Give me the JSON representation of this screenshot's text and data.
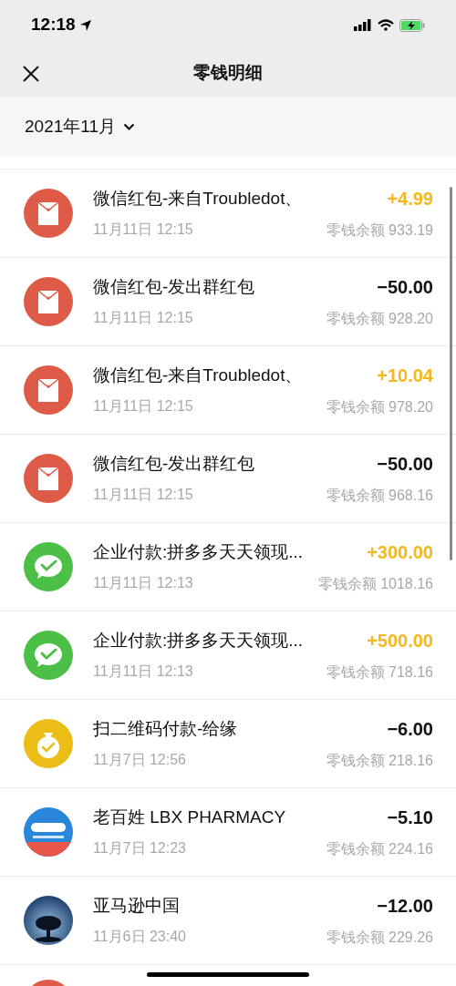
{
  "status_bar": {
    "time": "12:18"
  },
  "nav": {
    "title": "零钱明细"
  },
  "filter": {
    "month": "2021年11月"
  },
  "transactions": [
    {
      "kind": "red_packet",
      "title": "微信红包-来自Troubledot、",
      "date": "11月11日 12:15",
      "amount": "+4.99",
      "income": true,
      "balance": "零钱余额 933.19"
    },
    {
      "kind": "red_packet",
      "title": "微信红包-发出群红包",
      "date": "11月11日 12:15",
      "amount": "−50.00",
      "income": false,
      "balance": "零钱余额 928.20"
    },
    {
      "kind": "red_packet",
      "title": "微信红包-来自Troubledot、",
      "date": "11月11日 12:15",
      "amount": "+10.04",
      "income": true,
      "balance": "零钱余额 978.20"
    },
    {
      "kind": "red_packet",
      "title": "微信红包-发出群红包",
      "date": "11月11日 12:15",
      "amount": "−50.00",
      "income": false,
      "balance": "零钱余额 968.16"
    },
    {
      "kind": "wechat_pay",
      "title": "企业付款:拼多多天天领现...",
      "date": "11月11日 12:13",
      "amount": "+300.00",
      "income": true,
      "balance": "零钱余额 1018.16"
    },
    {
      "kind": "wechat_pay",
      "title": "企业付款:拼多多天天领现...",
      "date": "11月11日 12:13",
      "amount": "+500.00",
      "income": true,
      "balance": "零钱余额 718.16"
    },
    {
      "kind": "money_bag",
      "title": "扫二维码付款-给缘",
      "date": "11月7日 12:56",
      "amount": "−6.00",
      "income": false,
      "balance": "零钱余额 218.16"
    },
    {
      "kind": "pharmacy_logo",
      "title": "老百姓 LBX PHARMACY",
      "date": "11月7日 12:23",
      "amount": "−5.10",
      "income": false,
      "balance": "零钱余额 224.16"
    },
    {
      "kind": "kindle_logo",
      "title": "亚马逊中国",
      "date": "11月6日 23:40",
      "amount": "−12.00",
      "income": false,
      "balance": "零钱余额 229.26"
    }
  ]
}
